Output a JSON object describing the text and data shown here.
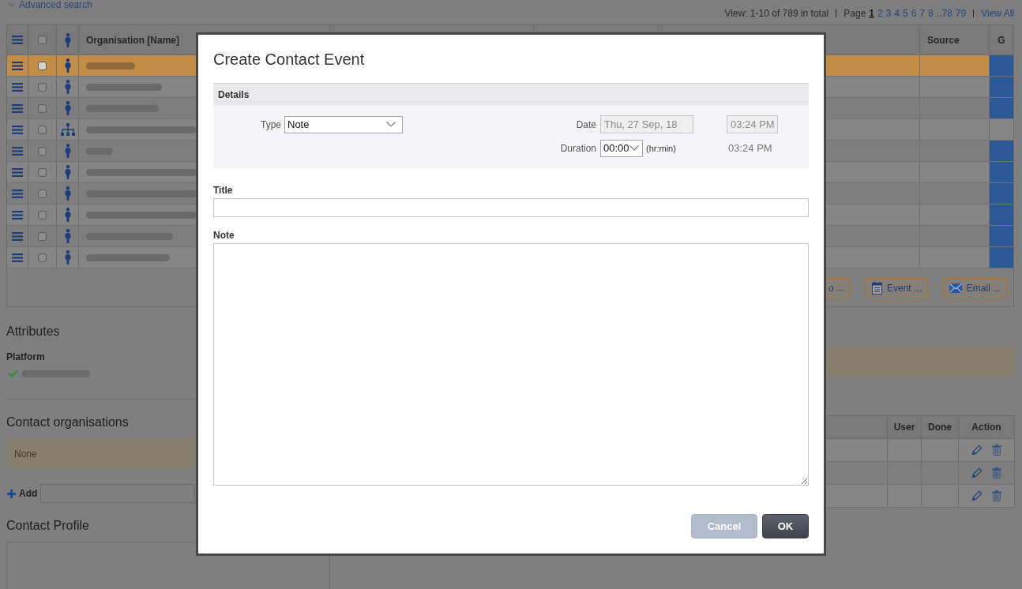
{
  "header": {
    "advanced_search": "Advanced search",
    "summary": "View: 1-10 of 789 in total",
    "page_label": "Page",
    "pages": [
      {
        "label": "1",
        "selected": true
      },
      {
        "label": "2",
        "selected": false
      },
      {
        "label": "3",
        "selected": false
      },
      {
        "label": "4",
        "selected": false
      },
      {
        "label": "5",
        "selected": false
      },
      {
        "label": "6",
        "selected": false
      },
      {
        "label": "7",
        "selected": false
      },
      {
        "label": "8",
        "selected": false
      },
      {
        "label": "..78",
        "selected": false
      },
      {
        "label": "79",
        "selected": false
      }
    ],
    "view_all": "View All"
  },
  "contacts_table": {
    "header_checkbox": {
      "checked": false
    },
    "columns": [
      "Organisation [Name]",
      "Source",
      "G"
    ],
    "rows": [
      {
        "kind": "person",
        "selected": true,
        "checked": false,
        "g_marked": true
      },
      {
        "kind": "person",
        "selected": false,
        "checked": false,
        "g_marked": true
      },
      {
        "kind": "person",
        "selected": false,
        "checked": false,
        "g_marked": true
      },
      {
        "kind": "organisation",
        "selected": false,
        "checked": false,
        "g_marked": false
      },
      {
        "kind": "person",
        "selected": false,
        "checked": false,
        "g_marked": true
      },
      {
        "kind": "person",
        "selected": false,
        "checked": false,
        "g_marked": true
      },
      {
        "kind": "person",
        "selected": false,
        "checked": false,
        "g_marked": true
      },
      {
        "kind": "person",
        "selected": false,
        "checked": false,
        "g_marked": true
      },
      {
        "kind": "person",
        "selected": false,
        "checked": false,
        "g_marked": true
      },
      {
        "kind": "person",
        "selected": false,
        "checked": false,
        "g_marked": true
      }
    ]
  },
  "toolbar": [
    {
      "kind": "partial",
      "label": "o ..."
    },
    {
      "kind": "event",
      "label": "Event ..."
    },
    {
      "kind": "email",
      "label": "Email ..."
    }
  ],
  "attributes": {
    "title": "Attributes",
    "fields": [
      {
        "label": "Platform",
        "checked": true
      }
    ]
  },
  "contact_organisations": {
    "title": "Contact organisations",
    "empty_text": "None",
    "add_label": "Add"
  },
  "contact_profile": {
    "title": "Contact Profile"
  },
  "events_table": {
    "columns": [
      "User",
      "Done",
      "Action"
    ],
    "rows": [
      {
        "editable": true,
        "deletable": true
      },
      {
        "editable": true,
        "deletable": true
      },
      {
        "editable": true,
        "deletable": true
      }
    ]
  },
  "dialog": {
    "title": "Create Contact Event",
    "details": {
      "heading": "Details",
      "type": {
        "label": "Type",
        "value": "Note"
      },
      "date": {
        "label": "Date",
        "value": "Thu, 27 Sep, 18",
        "disabled": true
      },
      "time": {
        "value": "03:24 PM",
        "disabled": true
      },
      "duration": {
        "label": "Duration",
        "value": "00:00",
        "unit": "(hr:min)"
      },
      "end_time": "03:24 PM"
    },
    "title_field": {
      "label": "Title"
    },
    "note_field": {
      "label": "Note"
    },
    "buttons": [
      {
        "kind": "cancel",
        "label": "Cancel"
      },
      {
        "kind": "confirm",
        "label": "OK"
      }
    ]
  }
}
